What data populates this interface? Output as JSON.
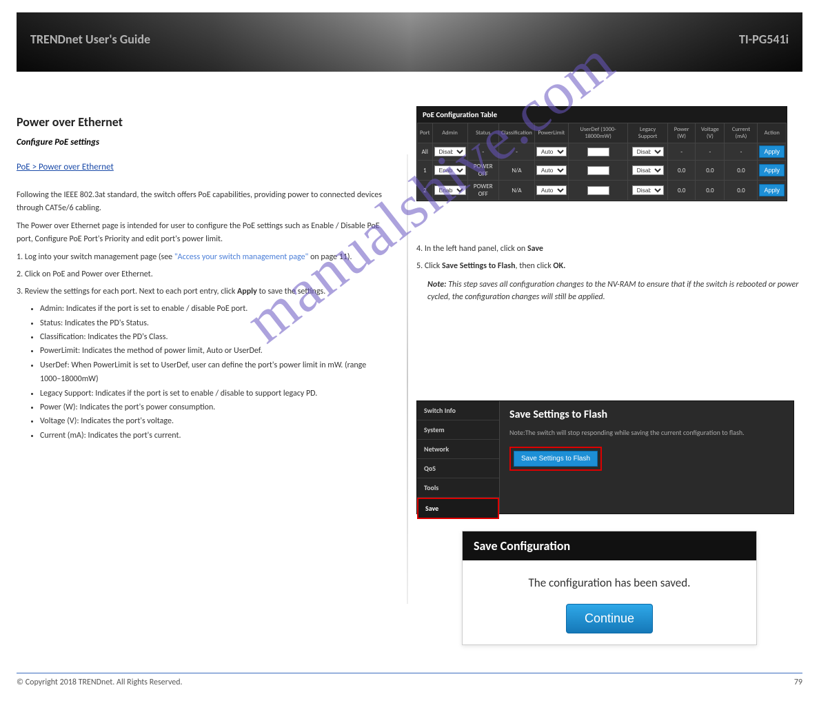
{
  "banner": {
    "left": "TRENDnet User's Guide",
    "right": "TI-PG541i"
  },
  "left": {
    "section": "Power over Ethernet",
    "subsection": "Configure PoE settings",
    "nav_path": "PoE > Power over Ethernet",
    "intro1": "Following the IEEE 802.3at standard, the switch offers PoE capabilities, providing power to connected devices through CAT5e/6 cabling.",
    "intro2": "The Power over Ethernet page is intended for user to configure the PoE settings such as Enable / Disable PoE port, Configure PoE Port's Priority and edit port's power limit.",
    "step1_pre": "1. Log into your switch management page (see ",
    "step1_link": "\"Access your switch management page\"",
    "step1_post": " on page 11).",
    "step2": "2. Click on PoE and Power over Ethernet.",
    "step3_pre": "3. Review the settings for each port. Next to each port entry, click ",
    "step3_bold": "Apply",
    "step3_post": " to save the settings.",
    "bullets": {
      "admin": "Admin: Indicates if the port is set to enable / disable PoE port.",
      "status": "Status: Indicates the PD's Status.",
      "classification": "Classification: Indicates the PD's Class.",
      "powerlimit": "PowerLimit: Indicates the method of power limit, Auto or UserDef.",
      "userdef": "UserDef: When PowerLimit is set to UserDef, user can define the port's power limit in mW. (range 1000–18000mW)",
      "legacy": "Legacy Support: Indicates if the port is set to enable / disable to support legacy PD.",
      "power": "Power (W): Indicates the port's power consumption.",
      "voltage": "Voltage (V): Indicates the port's voltage.",
      "current": "Current (mA): Indicates the port's current."
    },
    "step4_pre": "4. In the left hand panel, click on ",
    "step4_bold": "Save",
    "step5_pre": "5. Click ",
    "step5_bold": "Save Settings to Flash",
    "step5_mid": ", then click ",
    "step5_bold2": "OK.",
    "step5_note_pre": "Note: ",
    "step5_note": "This step saves all configuration changes to the NV-RAM to ensure that if the switch is rebooted or power cycled, the configuration changes will still be applied."
  },
  "poe": {
    "title": "PoE Configuration Table",
    "headers": {
      "port": "Port",
      "admin": "Admin",
      "status": "Status",
      "classification": "Classification",
      "powerlimit": "PowerLimit",
      "userdef": "UserDef (1000-18000mW)",
      "legacy": "Legacy Support",
      "power": "Power (W)",
      "voltage": "Voltage (V)",
      "current": "Current (mA)",
      "action": "Action"
    },
    "rows": [
      {
        "port": "All",
        "admin": "Disabled",
        "status": "-",
        "classification": "-",
        "powerlimit": "Auto",
        "userdef": "",
        "legacy": "Disabled",
        "power": "-",
        "voltage": "-",
        "current": "-",
        "action": "Apply"
      },
      {
        "port": "1",
        "admin": "Enabled",
        "status": "POWER OFF",
        "classification": "N/A",
        "powerlimit": "Auto",
        "userdef": "",
        "legacy": "Disabled",
        "power": "0.0",
        "voltage": "0.0",
        "current": "0.0",
        "action": "Apply"
      },
      {
        "port": "2",
        "admin": "Enabled",
        "status": "POWER OFF",
        "classification": "N/A",
        "powerlimit": "Auto",
        "userdef": "",
        "legacy": "Disabled",
        "power": "0.0",
        "voltage": "0.0",
        "current": "0.0",
        "action": "Apply"
      }
    ]
  },
  "save_panel": {
    "sidebar": [
      "Switch Info",
      "System",
      "Network",
      "QoS",
      "Tools",
      "Save"
    ],
    "title": "Save Settings to Flash",
    "note": "Note:The switch will stop responding while saving the current configuration to flash.",
    "button": "Save Settings to Flash"
  },
  "dialog": {
    "title": "Save Configuration",
    "message": "The configuration has been saved.",
    "button": "Continue"
  },
  "watermark": "manualshive.com",
  "footer": {
    "left": "© Copyright 2018 TRENDnet. All Rights Reserved.",
    "page": "79"
  }
}
